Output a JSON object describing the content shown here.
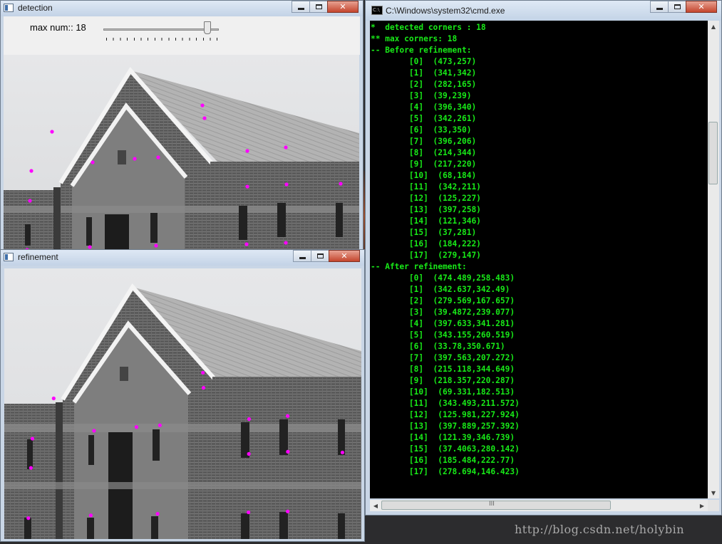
{
  "detection": {
    "title": "detection",
    "trackbar_label": "max num::",
    "trackbar_value": "18",
    "trackbar_fraction": 0.9
  },
  "refinement": {
    "title": "refinement"
  },
  "window_buttons": {
    "close": "✕"
  },
  "cmd": {
    "icon_text": "C:\\",
    "title": "C:\\Windows\\system32\\cmd.exe",
    "lines": [
      "*  detected corners : 18",
      "** max corners: 18",
      "-- Before refinement:",
      "        [0]  (473,257)",
      "        [1]  (341,342)",
      "        [2]  (282,165)",
      "        [3]  (39,239)",
      "        [4]  (396,340)",
      "        [5]  (342,261)",
      "        [6]  (33,350)",
      "        [7]  (396,206)",
      "        [8]  (214,344)",
      "        [9]  (217,220)",
      "        [10]  (68,184)",
      "        [11]  (342,211)",
      "        [12]  (125,227)",
      "        [13]  (397,258)",
      "        [14]  (121,346)",
      "        [15]  (37,281)",
      "        [16]  (184,222)",
      "        [17]  (279,147)",
      "-- After refinement:",
      "        [0]  (474.489,258.483)",
      "        [1]  (342.637,342.49)",
      "        [2]  (279.569,167.657)",
      "        [3]  (39.4872,239.077)",
      "        [4]  (397.633,341.281)",
      "        [5]  (343.155,260.519)",
      "        [6]  (33.78,350.671)",
      "        [7]  (397.563,207.272)",
      "        [8]  (215.118,344.649)",
      "        [9]  (218.357,220.287)",
      "        [10]  (69.331,182.513)",
      "        [11]  (343.493,211.572)",
      "        [12]  (125.981,227.924)",
      "        [13]  (397.889,257.392)",
      "        [14]  (121.39,346.739)",
      "        [15]  (37.4063,280.142)",
      "        [16]  (185.484,222.77)",
      "        [17]  (278.694,146.423)"
    ],
    "hscroll_grip": "III"
  },
  "watermark": "http://blog.csdn.net/holybin",
  "colors": {
    "corner_marker": "#ff00ff",
    "console_text": "#18ea18"
  },
  "icons": [
    "window-icon",
    "minimize-icon",
    "maximize-icon",
    "close-icon",
    "cmd-icon",
    "scroll-up-icon",
    "scroll-down-icon",
    "scroll-left-icon",
    "scroll-right-icon"
  ]
}
